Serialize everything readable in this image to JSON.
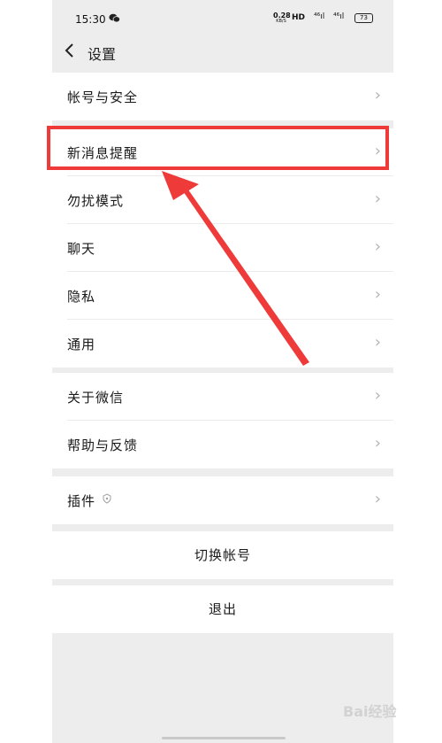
{
  "status_bar": {
    "time": "15:30",
    "net_speed_value": "0.28",
    "net_speed_unit": "KB/S",
    "hd_label": "HD",
    "signal_1": "⁴⁶ıl",
    "signal_2": "⁴⁶ıl",
    "battery": "73"
  },
  "header": {
    "title": "设置"
  },
  "settings": {
    "group1": [
      {
        "label": "帐号与安全"
      }
    ],
    "group2": [
      {
        "label": "新消息提醒"
      },
      {
        "label": "勿扰模式"
      },
      {
        "label": "聊天"
      },
      {
        "label": "隐私"
      },
      {
        "label": "通用"
      }
    ],
    "group3": [
      {
        "label": "关于微信"
      },
      {
        "label": "帮助与反馈"
      }
    ],
    "group4": [
      {
        "label": "插件"
      }
    ]
  },
  "actions": {
    "switch_account": "切换帐号",
    "logout": "退出"
  },
  "watermark": "Bai经验"
}
